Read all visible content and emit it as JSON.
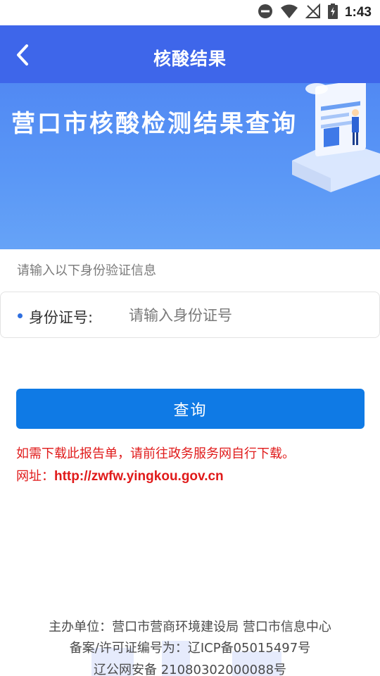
{
  "status_bar": {
    "time": "1:43"
  },
  "header": {
    "title": "核酸结果"
  },
  "banner": {
    "title": "营口市核酸检测结果查询"
  },
  "form": {
    "hint": "请输入以下身份验证信息",
    "id_label": "身份证号:",
    "id_placeholder": "请输入身份证号",
    "id_value": ""
  },
  "query_button": {
    "label": "查询"
  },
  "notice": {
    "line1": "如需下载此报告单，请前往政务服务网自行下载。",
    "url_label": "网址：",
    "url": "http://zwfw.yingkou.gov.cn"
  },
  "footer": {
    "line1": "主办单位：营口市营商环境建设局 营口市信息中心",
    "line2": "备案/许可证编号为：辽ICP备05015497号",
    "line3": "辽公网安备 21080302000088号"
  },
  "colors": {
    "appbar": "#3e66ea",
    "banner": "#5a97f6",
    "button": "#0f7ae5",
    "notice": "#e01a1a"
  }
}
